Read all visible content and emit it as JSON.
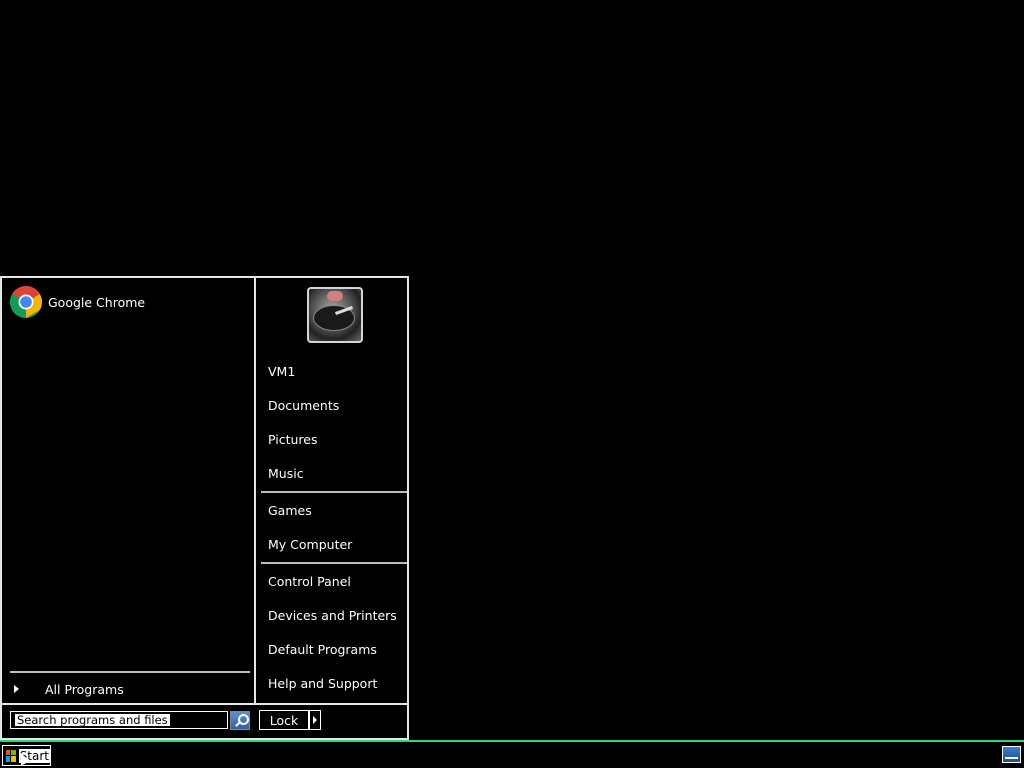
{
  "start_menu": {
    "pinned": [
      {
        "label": "Google Chrome",
        "icon": "chrome-icon"
      }
    ],
    "all_programs_label": "All Programs",
    "user_picture": "user-avatar",
    "right_items_group1": [
      "VM1",
      "Documents",
      "Pictures",
      "Music"
    ],
    "right_items_group2": [
      "Games",
      "My Computer"
    ],
    "right_items_group3": [
      "Control Panel",
      "Devices and Printers",
      "Default Programs",
      "Help and Support"
    ],
    "search": {
      "placeholder": "Search programs and files",
      "value": ""
    },
    "lock_label": "Lock"
  },
  "taskbar": {
    "start_label": "Start",
    "accent_color": "#2fd66f",
    "tray_icon": "action-center-icon"
  }
}
